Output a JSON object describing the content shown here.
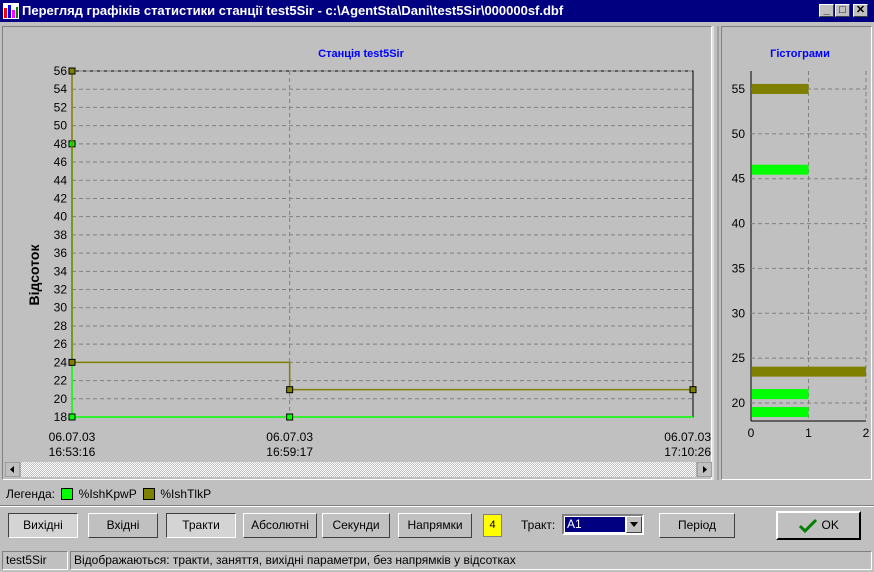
{
  "window": {
    "title": "Перегляд графіків статистики станції test5Sir - c:\\AgentSta\\Dani\\test5Sir\\000000sf.dbf",
    "minimize": "_",
    "maximize": "□",
    "close": "✕",
    "icon": "bar-chart-icon"
  },
  "chart_data": [
    {
      "type": "line",
      "title": "Станція test5Sir",
      "ylabel": "Відсоток",
      "xlabel": "",
      "ylim": [
        18,
        56
      ],
      "y_ticks": [
        "18",
        "20",
        "22",
        "24",
        "26",
        "28",
        "30",
        "32",
        "34",
        "36",
        "38",
        "40",
        "42",
        "44",
        "46",
        "48",
        "50",
        "52",
        "54",
        "56"
      ],
      "x_ticks": [
        {
          "date": "06.07.03",
          "time": "16:53:16"
        },
        {
          "date": "06.07.03",
          "time": "16:59:17"
        },
        {
          "date": "06.07.03",
          "time": "17:10:26"
        }
      ],
      "grid": true,
      "series": [
        {
          "name": "%IshKpwP",
          "color": "#00ff00",
          "step": true,
          "x": [
            "16:53:16",
            "16:53:16",
            "16:59:17",
            "17:10:26"
          ],
          "y": [
            48,
            18,
            18,
            18
          ],
          "markers": [
            "16:53:16",
            "16:59:17"
          ]
        },
        {
          "name": "%IshTlkP",
          "color": "#808000",
          "step": true,
          "x": [
            "16:53:16",
            "16:53:16",
            "16:59:17",
            "16:59:17",
            "17:10:26"
          ],
          "y": [
            56,
            24,
            24,
            21,
            21
          ],
          "markers": [
            "16:53:16",
            "16:59:17",
            "17:10:26"
          ]
        }
      ]
    },
    {
      "type": "bar",
      "orientation": "horizontal",
      "title": "Гістограми",
      "xlim": [
        0,
        2
      ],
      "ylim": [
        18,
        57
      ],
      "x_ticks": [
        "0",
        "1",
        "2"
      ],
      "y_ticks": [
        "20",
        "25",
        "30",
        "35",
        "40",
        "45",
        "50",
        "55"
      ],
      "grid": true,
      "series": [
        {
          "name": "%IshKpwP",
          "color": "#00ff00",
          "bins": [
            {
              "y": 46,
              "count": 1
            },
            {
              "y": 21,
              "count": 1
            },
            {
              "y": 19,
              "count": 1
            }
          ]
        },
        {
          "name": "%IshTlkP",
          "color": "#808000",
          "bins": [
            {
              "y": 55,
              "count": 1
            },
            {
              "y": 23.5,
              "count": 2
            }
          ]
        }
      ]
    }
  ],
  "legend": {
    "label": "Легенда:",
    "items": [
      {
        "name": "%IshKpwP",
        "color": "#00ff00"
      },
      {
        "name": "%IshTlkP",
        "color": "#808000"
      }
    ]
  },
  "toolbar": {
    "outputs": "Вихідні",
    "inputs": "Вхідні",
    "paths": "Тракти",
    "absolute": "Абсолютні",
    "seconds": "Секунди",
    "directions": "Напрямки",
    "counter": "4",
    "path_label": "Тракт:",
    "path_value": "A1",
    "period": "Період",
    "ok": "OK"
  },
  "status": {
    "station": "test5Sir",
    "message": "Відображаються: тракти, заняття, вихідні параметри, без напрямків у відсотках"
  }
}
